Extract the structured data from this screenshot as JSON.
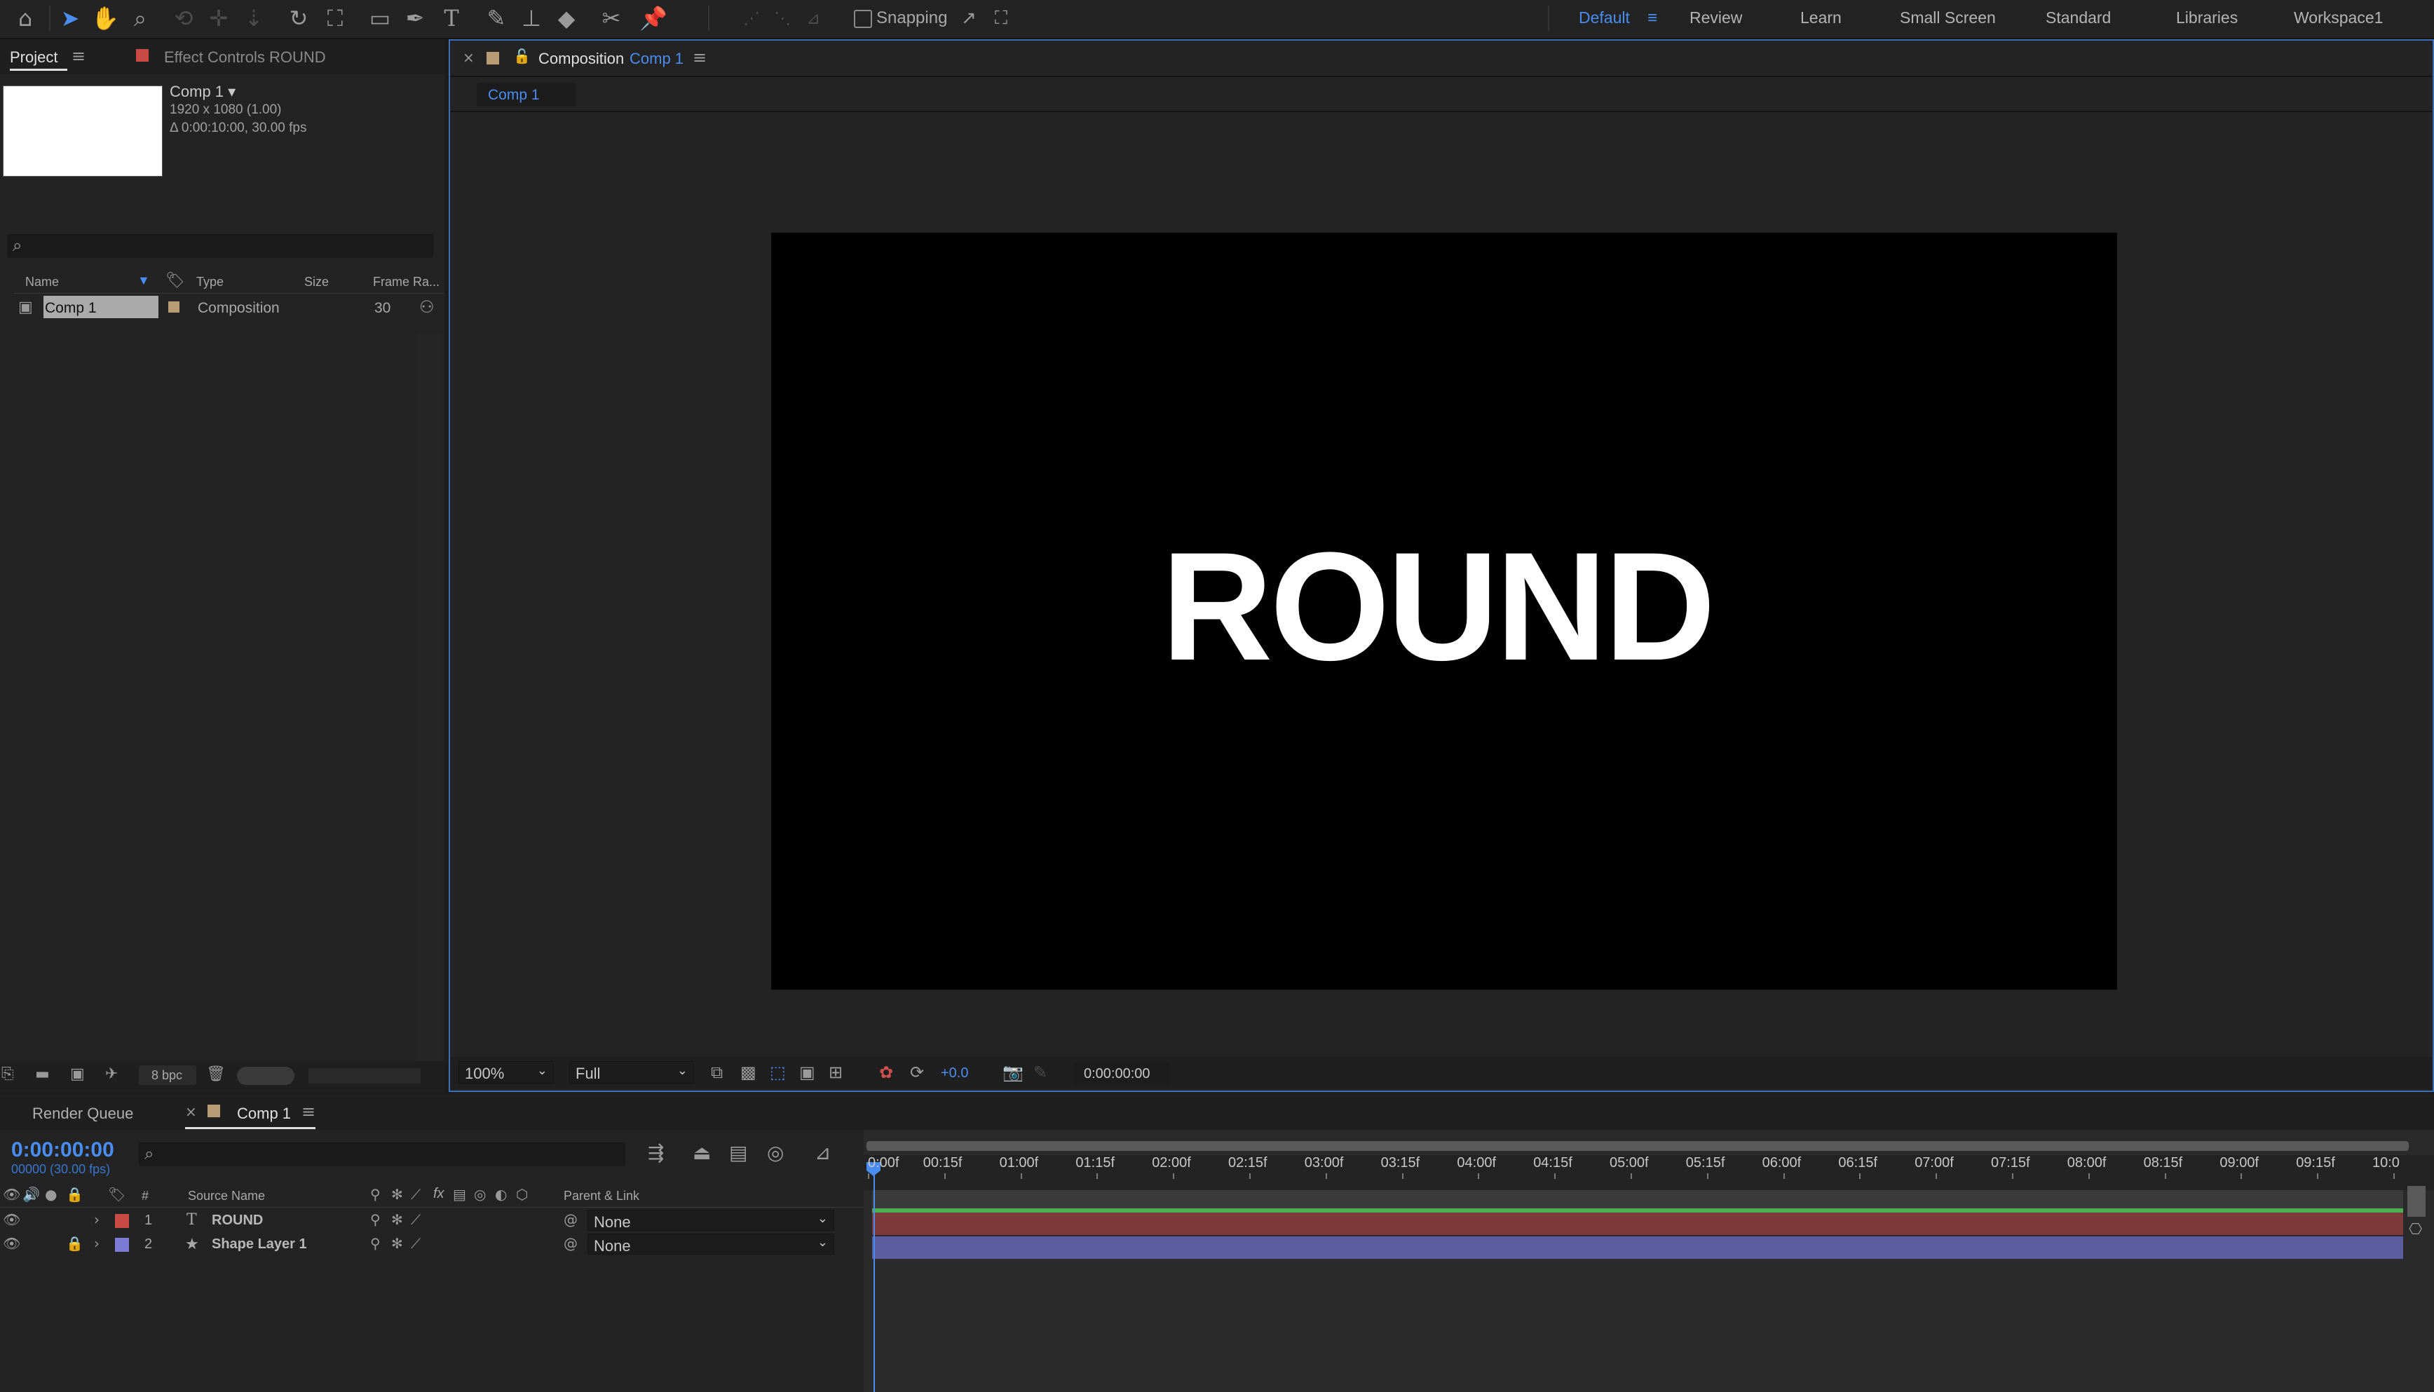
{
  "toolbar": {
    "snapping_label": "Snapping",
    "tools": [
      "home-icon",
      "selection-icon",
      "hand-icon",
      "zoom-icon",
      "orbit-icon",
      "track-xy-icon",
      "track-z-icon",
      "rotate-icon",
      "pan-behind-icon",
      "rectangle-icon",
      "pen-icon",
      "type-icon",
      "brush-icon",
      "clone-stamp-icon",
      "eraser-icon",
      "roto-brush-icon",
      "puppet-pin-icon"
    ]
  },
  "workspaces": {
    "items": [
      "Default",
      "Review",
      "Learn",
      "Small Screen",
      "Standard",
      "Libraries",
      "Workspace1"
    ],
    "active": "Default"
  },
  "project_panel": {
    "tab_label": "Project",
    "effect_controls_label": "Effect Controls ROUND",
    "preview": {
      "name": "Comp 1 ▾",
      "resolution": "1920 x 1080 (1.00)",
      "duration": "Δ 0:00:10:00, 30.00 fps"
    },
    "columns": [
      "Name",
      "Type",
      "Size",
      "Frame Ra..."
    ],
    "items": [
      {
        "name": "Comp 1",
        "type": "Composition",
        "size": "",
        "frame_rate": "30"
      }
    ],
    "bpc_label": "8 bpc"
  },
  "comp_panel": {
    "header_prefix": "Composition",
    "header_comp": "Comp 1",
    "tab_label": "Comp 1",
    "canvas_text": "ROUND",
    "zoom": "100%",
    "resolution": "Full",
    "exposure": "+0.0",
    "timecode": "0:00:00:00"
  },
  "timeline": {
    "render_queue_label": "Render Queue",
    "comp_tab_label": "Comp 1",
    "current_time": "0:00:00:00",
    "frame_info": "00000 (30.00 fps)",
    "columns": {
      "num": "#",
      "source": "Source Name",
      "parent": "Parent & Link"
    },
    "layers": [
      {
        "num": "1",
        "name": "ROUND",
        "type_icon": "T",
        "color": "#c94a45",
        "parent": "None",
        "locked": false
      },
      {
        "num": "2",
        "name": "Shape Layer 1",
        "type_icon": "★",
        "color": "#7c7cd6",
        "parent": "None",
        "locked": true
      }
    ],
    "ruler_ticks": [
      "0:00f",
      "00:15f",
      "01:00f",
      "01:15f",
      "02:00f",
      "02:15f",
      "03:00f",
      "03:15f",
      "04:00f",
      "04:15f",
      "05:00f",
      "05:15f",
      "06:00f",
      "06:15f",
      "07:00f",
      "07:15f",
      "08:00f",
      "08:15f",
      "09:00f",
      "09:15f",
      "10:0"
    ]
  },
  "colors": {
    "accent": "#4a8df0",
    "layer1_bar": "#7d3a3a",
    "layer2_bar": "#5c5ca0",
    "work_area": "#4caf50"
  }
}
